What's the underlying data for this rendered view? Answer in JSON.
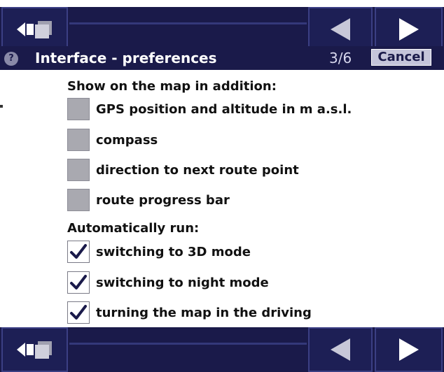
{
  "header": {
    "help_icon": "?",
    "title": "Interface - preferences",
    "page": "3/6",
    "cancel_label": "Cancel"
  },
  "icons": {
    "menu": "back-windows-icon",
    "prev": "triangle-left-icon",
    "next": "triangle-right-icon",
    "checkmark": "checkmark-icon"
  },
  "colors": {
    "toolbar_bg": "#1a1a4a",
    "button_border": "#3b3f84",
    "checkbox_unchecked": "#a9a9b0",
    "check_mark": "#1a1a4a"
  },
  "sections": [
    {
      "title": "Show on the map in addition:",
      "options": [
        {
          "label": "GPS position and altitude in m a.s.l.",
          "checked": false
        },
        {
          "label": "compass",
          "checked": false
        },
        {
          "label": "direction to next route point",
          "checked": false
        },
        {
          "label": "route progress bar",
          "checked": false
        }
      ]
    },
    {
      "title": "Automatically run:",
      "options": [
        {
          "label": "switching to 3D mode",
          "checked": true
        },
        {
          "label": "switching to night mode",
          "checked": true
        },
        {
          "label": "turning the map in the driving",
          "checked": true
        }
      ]
    }
  ]
}
